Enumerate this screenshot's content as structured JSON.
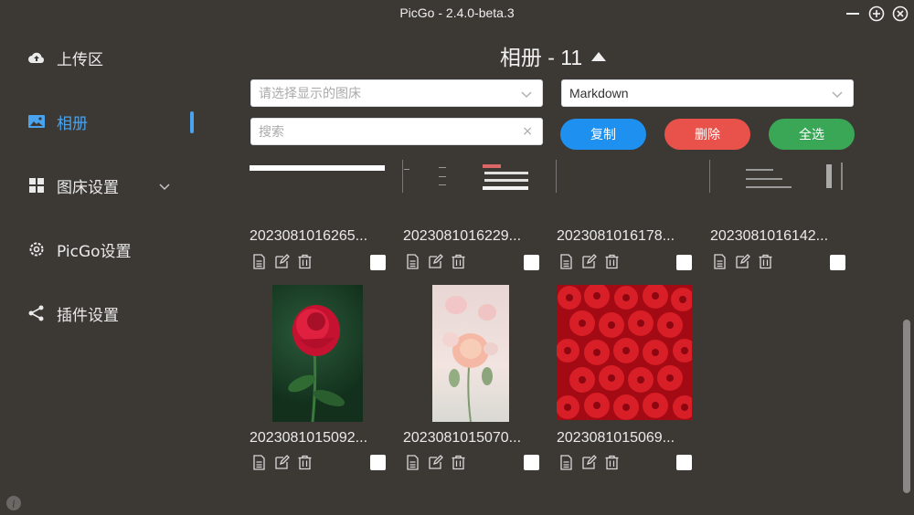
{
  "window": {
    "title": "PicGo - 2.4.0-beta.3"
  },
  "sidebar": {
    "items": [
      {
        "label": "上传区",
        "icon": "cloud-upload-icon"
      },
      {
        "label": "相册",
        "icon": "image-icon",
        "active": true
      },
      {
        "label": "图床设置",
        "icon": "grid-icon"
      },
      {
        "label": "PicGo设置",
        "icon": "gear-icon"
      },
      {
        "label": "插件设置",
        "icon": "share-icon"
      }
    ],
    "accent": "#4aa3ef"
  },
  "album": {
    "title": "相册 - 11"
  },
  "filters": {
    "picbed_placeholder": "请选择显示的图床",
    "format_value": "Markdown",
    "search_placeholder": "搜索",
    "search_clear": "×"
  },
  "actions": {
    "copy_label": "复制",
    "delete_label": "删除",
    "select_all_label": "全选",
    "colors": {
      "copy": "#1e90ef",
      "delete": "#e9524a",
      "select_all": "#3aa757"
    }
  },
  "gallery": {
    "items": [
      {
        "filename": "2023081016265...",
        "checked": false
      },
      {
        "filename": "2023081016229...",
        "checked": false
      },
      {
        "filename": "2023081016178...",
        "checked": false
      },
      {
        "filename": "2023081016142...",
        "checked": false
      },
      {
        "filename": "2023081015092...",
        "checked": false
      },
      {
        "filename": "2023081015070...",
        "checked": false
      },
      {
        "filename": "2023081015069...",
        "checked": false
      }
    ]
  }
}
